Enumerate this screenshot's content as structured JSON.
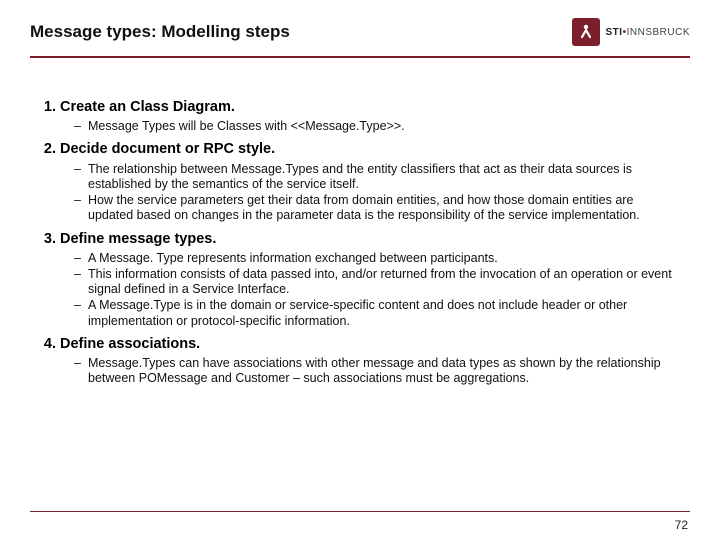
{
  "header": {
    "title": "Message types: Modelling steps",
    "logo_label": "STI",
    "logo_sub": "INNSBRUCK"
  },
  "steps": [
    {
      "heading": "Create an Class Diagram.",
      "bullets": [
        "Message Types will be Classes with <<Message.Type>>."
      ]
    },
    {
      "heading": "Decide document or RPC style.",
      "bullets": [
        "The relationship between Message.Types and the entity classifiers that act as their data sources is established by the semantics of the service itself.",
        "How the service parameters get their data from domain entities, and how those domain entities are updated based on changes in the parameter data is the responsibility of the service implementation."
      ]
    },
    {
      "heading": "Define message types.",
      "bullets": [
        "A Message. Type represents information exchanged between participants.",
        "This information consists of data passed into, and/or returned from the invocation of an operation or event signal defined in a Service Interface.",
        "A Message.Type is in the domain or service-specific content and does not include header or other implementation or protocol-specific information."
      ]
    },
    {
      "heading": "Define associations.",
      "bullets": [
        "Message.Types can have associations with other message and data types as shown by the relationship between POMessage and Customer – such associations must be aggregations."
      ]
    }
  ],
  "page_number": "72"
}
